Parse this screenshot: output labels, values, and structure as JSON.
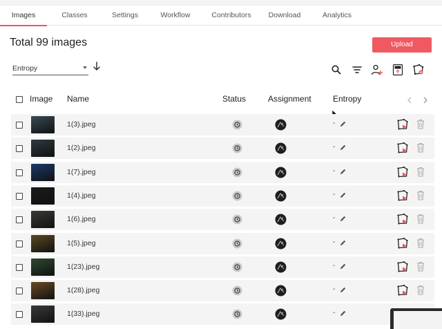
{
  "tabs": [
    {
      "label": "Images",
      "active": true
    },
    {
      "label": "Classes",
      "active": false
    },
    {
      "label": "Settings",
      "active": false
    },
    {
      "label": "Workflow",
      "active": false
    },
    {
      "label": "Contributors",
      "active": false
    },
    {
      "label": "Download",
      "active": false
    },
    {
      "label": "Analytics",
      "active": false
    }
  ],
  "page": {
    "title": "Total 99 images",
    "upload_label": "Upload"
  },
  "sort": {
    "selected": "Entropy",
    "direction": "descending"
  },
  "toolbar": {
    "icons": [
      "search-icon",
      "filter-icon",
      "add-user-icon",
      "csv-upload-icon",
      "settings-annotate-icon"
    ]
  },
  "table": {
    "columns": [
      "Image",
      "Name",
      "Status",
      "Assignment",
      "Entropy"
    ],
    "rows": [
      {
        "name": "1(3).jpeg",
        "entropy": "-",
        "thumb_color": "#3a4a55"
      },
      {
        "name": "1(2).jpeg",
        "entropy": "-",
        "thumb_color": "#2e3a40"
      },
      {
        "name": "1(7).jpeg",
        "entropy": "-",
        "thumb_color": "#1c3a6a"
      },
      {
        "name": "1(4).jpeg",
        "entropy": "-",
        "thumb_color": "#1a1a1e"
      },
      {
        "name": "1(6).jpeg",
        "entropy": "-",
        "thumb_color": "#3b3a36"
      },
      {
        "name": "1(5).jpeg",
        "entropy": "-",
        "thumb_color": "#5a4a22"
      },
      {
        "name": "1(23).jpeg",
        "entropy": "-",
        "thumb_color": "#2f4a30"
      },
      {
        "name": "1(28).jpeg",
        "entropy": "-",
        "thumb_color": "#6a4a28"
      },
      {
        "name": "1(33).jpeg",
        "entropy": "-",
        "thumb_color": "#3a3a3a"
      }
    ]
  },
  "colors": {
    "accent": "#ef5a62",
    "row_bg": "#f4f4f4"
  }
}
